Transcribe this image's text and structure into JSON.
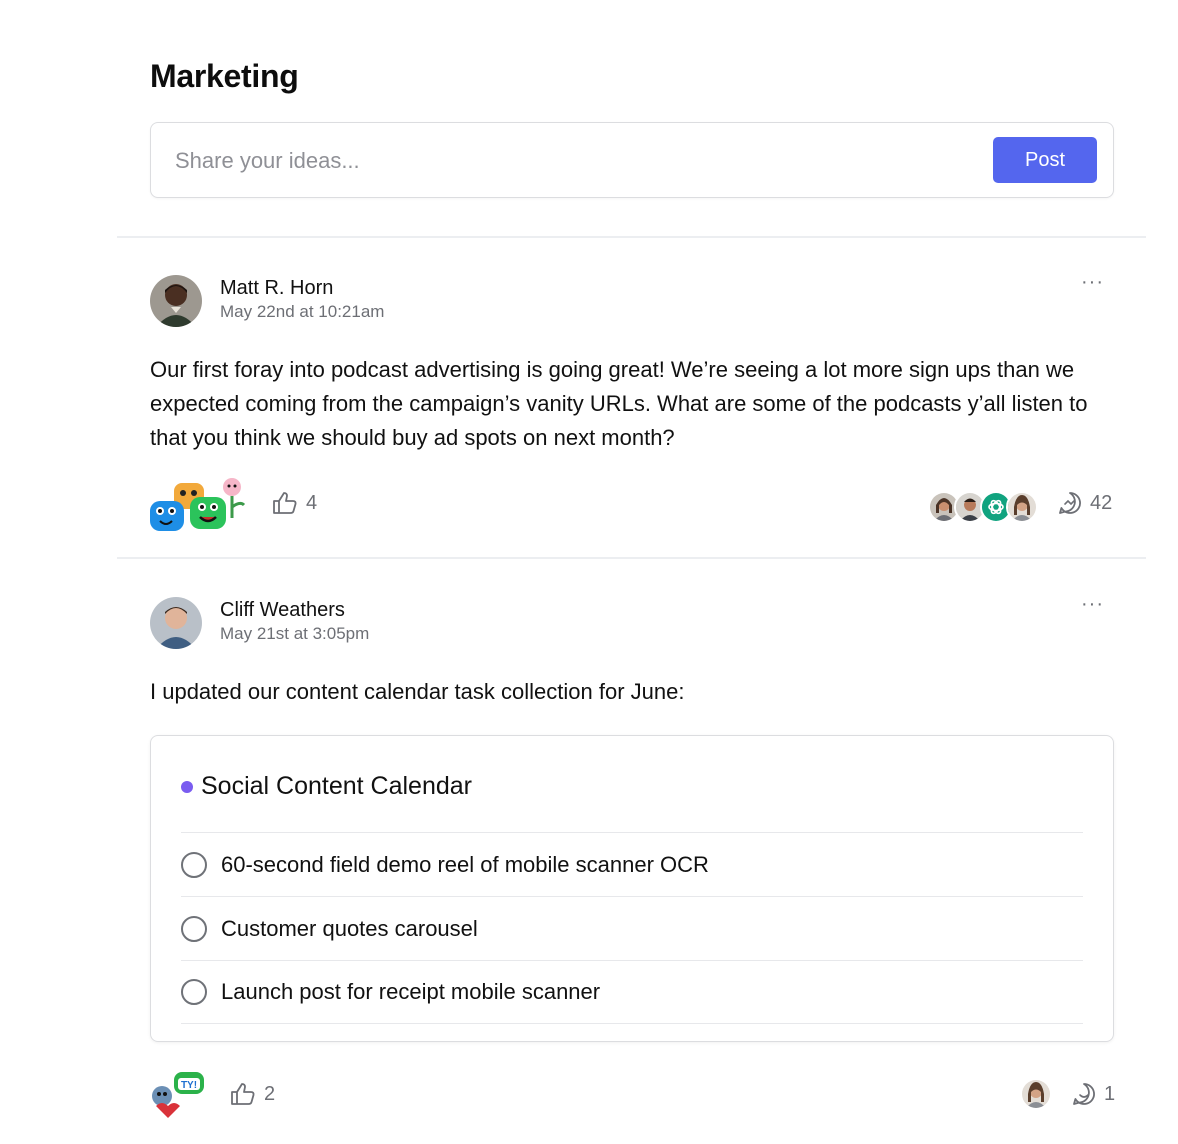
{
  "page": {
    "title": "Marketing"
  },
  "composer": {
    "placeholder": "Share your ideas...",
    "post_label": "Post"
  },
  "posts": [
    {
      "author": "Matt R. Horn",
      "timestamp": "May 22nd at 10:21am",
      "more": "···",
      "body": "Our first foray into podcast advertising is going great! We’re seeing a lot more sign ups than we expected coming from the campaign’s vanity URLs. What are some of the podcasts y’all listen to that you think we should buy ad spots on next month?",
      "likes": "4",
      "comments": "42",
      "commenter_icons": [
        "avatar-woman",
        "avatar-man",
        "openai-icon",
        "avatar-woman-2"
      ]
    },
    {
      "author": "Cliff Weathers",
      "timestamp": "May 21st at 3:05pm",
      "more": "···",
      "body": "I updated our content calendar task collection for June:",
      "likes": "2",
      "comments": "1",
      "commenter_icons": [
        "avatar-woman"
      ]
    }
  ],
  "task_collection": {
    "title": "Social Content Calendar",
    "dot_color": "#7a5cf0",
    "tasks": [
      "60-second field demo reel of mobile scanner OCR",
      "Customer quotes carousel",
      "Launch post for receipt mobile scanner"
    ]
  },
  "colors": {
    "accent": "#5466ee",
    "muted_text": "#6d6f75",
    "border": "#dcdde0"
  }
}
